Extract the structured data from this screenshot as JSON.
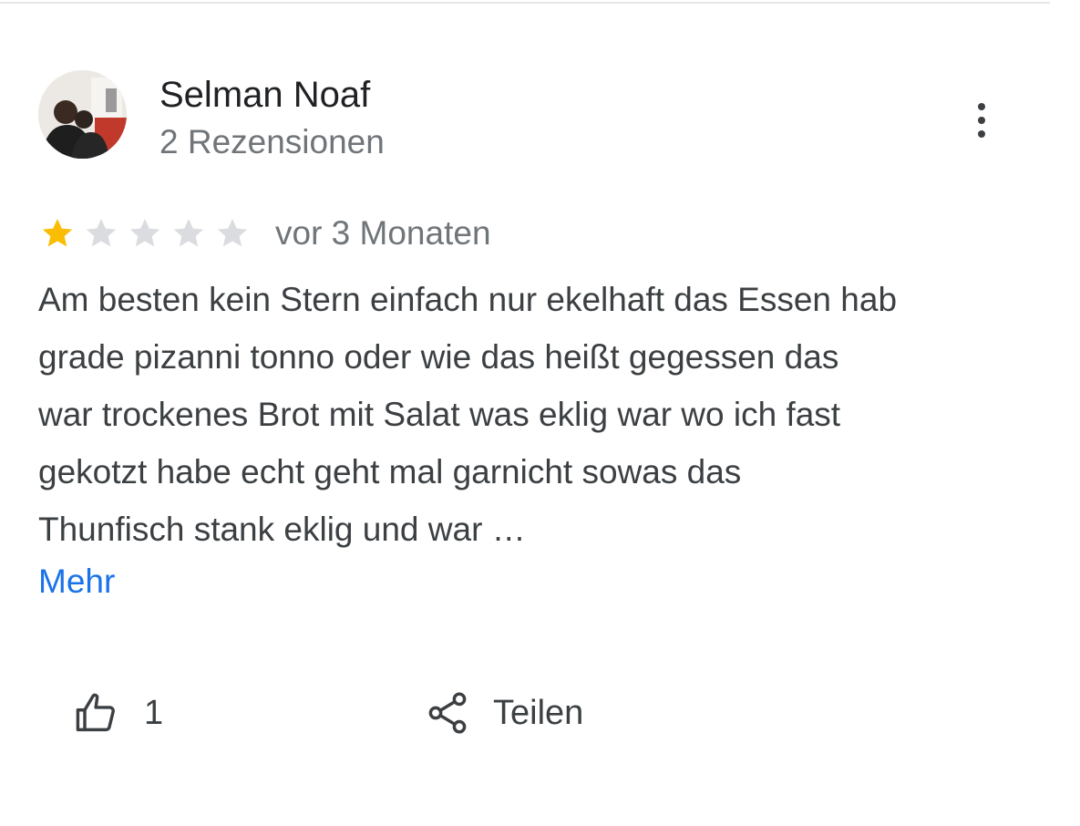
{
  "reviewer": {
    "name": "Selman Noaf",
    "meta": "2 Rezensionen"
  },
  "review": {
    "rating": 1,
    "max_rating": 5,
    "date": "vor 3 Monaten",
    "text_lines": [
      "Am besten kein Stern einfach nur ekelhaft das Essen hab",
      "grade pizanni tonno oder wie das heißt gegessen das",
      "war trockenes Brot mit Salat was eklig war wo ich fast",
      "gekotzt habe echt geht mal garnicht sowas das",
      "Thunfisch stank eklig und war …"
    ],
    "more_label": "Mehr"
  },
  "actions": {
    "like_count": "1",
    "share_label": "Teilen"
  },
  "icons": {
    "more": "more-vert-icon",
    "like": "thumb-up-icon",
    "share": "share-icon",
    "star": "star-icon"
  },
  "colors": {
    "star_filled": "#fbbc04",
    "star_empty": "#dadce0",
    "link": "#1a73e8",
    "text_primary": "#202124",
    "text_secondary": "#70757a"
  }
}
